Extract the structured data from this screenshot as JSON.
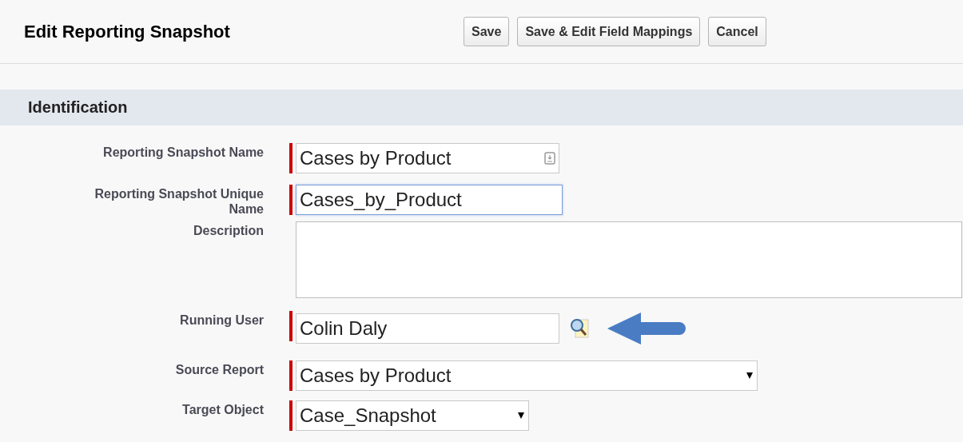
{
  "header": {
    "title": "Edit Reporting Snapshot",
    "buttons": [
      "Save",
      "Save & Edit Field Mappings",
      "Cancel"
    ]
  },
  "section": {
    "title": "Identification"
  },
  "fields": [
    {
      "label": "Reporting Snapshot Name",
      "kind": "text",
      "value": "Cases by Product",
      "required": true,
      "focused": false
    },
    {
      "label": "Reporting Snapshot Unique Name",
      "kind": "text",
      "value": "Cases_by_Product",
      "required": true,
      "focused": true
    },
    {
      "label": "Description",
      "kind": "textarea",
      "required": false,
      "focused": false
    },
    {
      "label": "Running User",
      "kind": "lookup",
      "value": "Colin Daly",
      "required": true,
      "focused": false
    },
    {
      "label": "Source Report",
      "kind": "select",
      "value": "Cases by Product",
      "required": true,
      "focused": false
    },
    {
      "label": "Target Object",
      "kind": "select",
      "value": "Case_Snapshot",
      "required": true,
      "focused": false
    }
  ]
}
